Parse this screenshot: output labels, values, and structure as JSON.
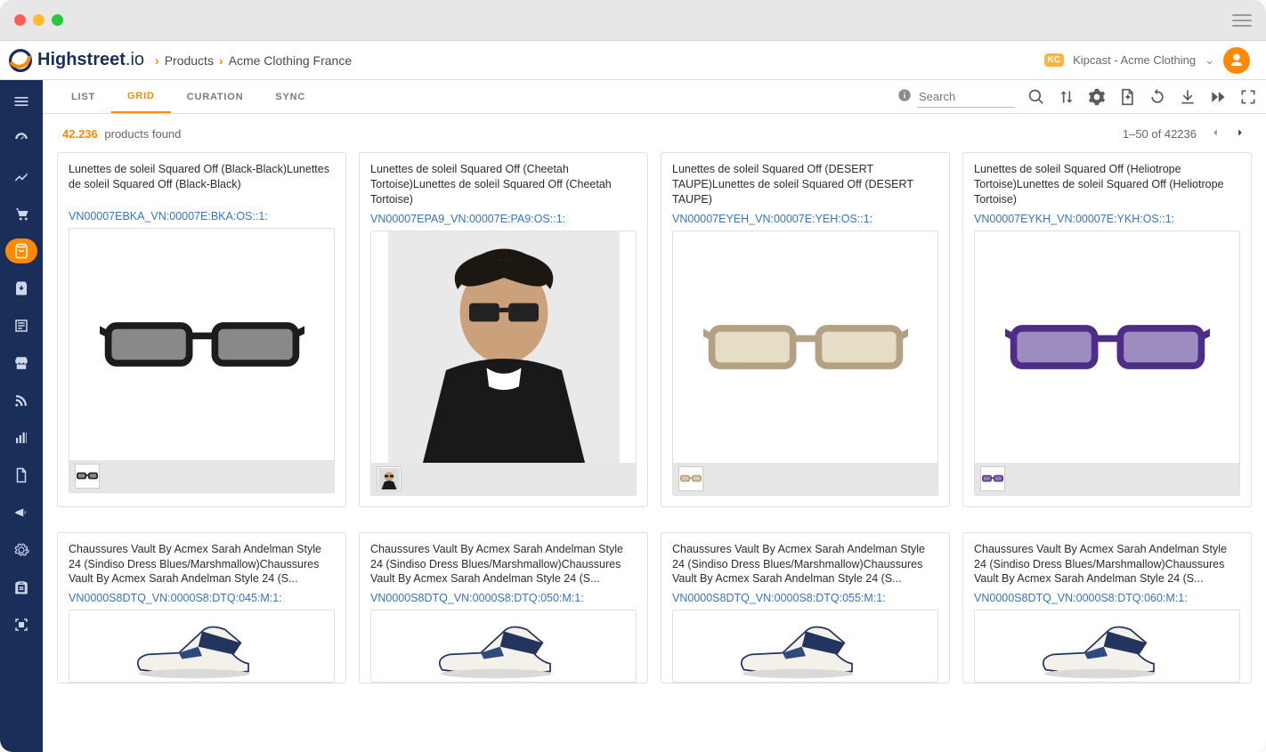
{
  "brand": {
    "name": "Highstreet",
    "suffix": ".io"
  },
  "breadcrumbs": {
    "root": "Products",
    "current": "Acme Clothing France"
  },
  "user": {
    "badge": "KC",
    "org": "Kipcast - Acme Clothing"
  },
  "tabs": {
    "list": "LIST",
    "grid": "GRID",
    "curation": "CURATION",
    "sync": "SYNC"
  },
  "search": {
    "placeholder": "Search"
  },
  "results": {
    "count": "42.236",
    "label": "products found",
    "page_range": "1–50 of 42236"
  },
  "products": [
    {
      "title": "Lunettes de soleil Squared Off (Black-Black)Lunettes de soleil Squared Off (Black-Black)",
      "sku": "VN00007EBKA_VN:00007E:BKA:OS::1:",
      "variant": "black-glasses"
    },
    {
      "title": "Lunettes de soleil Squared Off (Cheetah Tortoise)Lunettes de soleil Squared Off (Cheetah Tortoise)",
      "sku": "VN00007EPA9_VN:00007E:PA9:OS::1:",
      "variant": "model-photo"
    },
    {
      "title": "Lunettes de soleil Squared Off (DESERT TAUPE)Lunettes de soleil Squared Off (DESERT TAUPE)",
      "sku": "VN00007EYEH_VN:00007E:YEH:OS::1:",
      "variant": "taupe-glasses"
    },
    {
      "title": "Lunettes de soleil Squared Off (Heliotrope Tortoise)Lunettes de soleil Squared Off (Heliotrope Tortoise)",
      "sku": "VN00007EYKH_VN:00007E:YKH:OS::1:",
      "variant": "purple-glasses"
    },
    {
      "title": "Chaussures Vault By Acmex Sarah Andelman Style 24 (Sindiso Dress Blues/Marshmallow)Chaussures Vault By Acmex Sarah Andelman Style 24 (S...",
      "sku": "VN0000S8DTQ_VN:0000S8:DTQ:045:M:1:",
      "variant": "shoe"
    },
    {
      "title": "Chaussures Vault By Acmex Sarah Andelman Style 24 (Sindiso Dress Blues/Marshmallow)Chaussures Vault By Acmex Sarah Andelman Style 24 (S...",
      "sku": "VN0000S8DTQ_VN:0000S8:DTQ:050:M:1:",
      "variant": "shoe"
    },
    {
      "title": "Chaussures Vault By Acmex Sarah Andelman Style 24 (Sindiso Dress Blues/Marshmallow)Chaussures Vault By Acmex Sarah Andelman Style 24 (S...",
      "sku": "VN0000S8DTQ_VN:0000S8:DTQ:055:M:1:",
      "variant": "shoe"
    },
    {
      "title": "Chaussures Vault By Acmex Sarah Andelman Style 24 (Sindiso Dress Blues/Marshmallow)Chaussures Vault By Acmex Sarah Andelman Style 24 (S...",
      "sku": "VN0000S8DTQ_VN:0000S8:DTQ:060:M:1:",
      "variant": "shoe"
    }
  ]
}
